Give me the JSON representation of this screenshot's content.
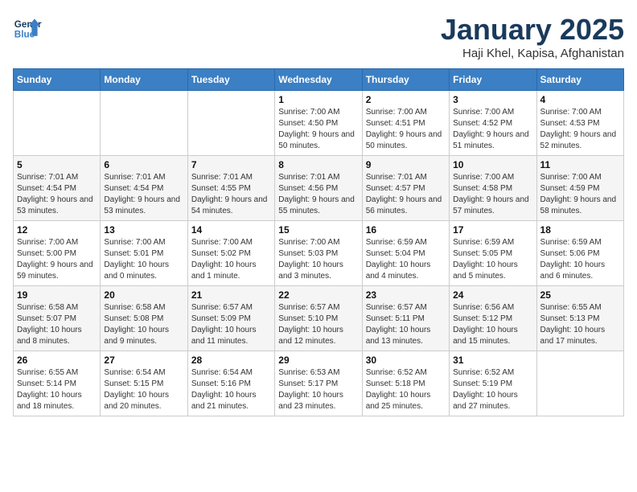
{
  "logo": {
    "line1": "General",
    "line2": "Blue"
  },
  "title": "January 2025",
  "subtitle": "Haji Khel, Kapisa, Afghanistan",
  "weekdays": [
    "Sunday",
    "Monday",
    "Tuesday",
    "Wednesday",
    "Thursday",
    "Friday",
    "Saturday"
  ],
  "weeks": [
    [
      {
        "day": "",
        "info": ""
      },
      {
        "day": "",
        "info": ""
      },
      {
        "day": "",
        "info": ""
      },
      {
        "day": "1",
        "info": "Sunrise: 7:00 AM\nSunset: 4:50 PM\nDaylight: 9 hours and 50 minutes."
      },
      {
        "day": "2",
        "info": "Sunrise: 7:00 AM\nSunset: 4:51 PM\nDaylight: 9 hours and 50 minutes."
      },
      {
        "day": "3",
        "info": "Sunrise: 7:00 AM\nSunset: 4:52 PM\nDaylight: 9 hours and 51 minutes."
      },
      {
        "day": "4",
        "info": "Sunrise: 7:00 AM\nSunset: 4:53 PM\nDaylight: 9 hours and 52 minutes."
      }
    ],
    [
      {
        "day": "5",
        "info": "Sunrise: 7:01 AM\nSunset: 4:54 PM\nDaylight: 9 hours and 53 minutes."
      },
      {
        "day": "6",
        "info": "Sunrise: 7:01 AM\nSunset: 4:54 PM\nDaylight: 9 hours and 53 minutes."
      },
      {
        "day": "7",
        "info": "Sunrise: 7:01 AM\nSunset: 4:55 PM\nDaylight: 9 hours and 54 minutes."
      },
      {
        "day": "8",
        "info": "Sunrise: 7:01 AM\nSunset: 4:56 PM\nDaylight: 9 hours and 55 minutes."
      },
      {
        "day": "9",
        "info": "Sunrise: 7:01 AM\nSunset: 4:57 PM\nDaylight: 9 hours and 56 minutes."
      },
      {
        "day": "10",
        "info": "Sunrise: 7:00 AM\nSunset: 4:58 PM\nDaylight: 9 hours and 57 minutes."
      },
      {
        "day": "11",
        "info": "Sunrise: 7:00 AM\nSunset: 4:59 PM\nDaylight: 9 hours and 58 minutes."
      }
    ],
    [
      {
        "day": "12",
        "info": "Sunrise: 7:00 AM\nSunset: 5:00 PM\nDaylight: 9 hours and 59 minutes."
      },
      {
        "day": "13",
        "info": "Sunrise: 7:00 AM\nSunset: 5:01 PM\nDaylight: 10 hours and 0 minutes."
      },
      {
        "day": "14",
        "info": "Sunrise: 7:00 AM\nSunset: 5:02 PM\nDaylight: 10 hours and 1 minute."
      },
      {
        "day": "15",
        "info": "Sunrise: 7:00 AM\nSunset: 5:03 PM\nDaylight: 10 hours and 3 minutes."
      },
      {
        "day": "16",
        "info": "Sunrise: 6:59 AM\nSunset: 5:04 PM\nDaylight: 10 hours and 4 minutes."
      },
      {
        "day": "17",
        "info": "Sunrise: 6:59 AM\nSunset: 5:05 PM\nDaylight: 10 hours and 5 minutes."
      },
      {
        "day": "18",
        "info": "Sunrise: 6:59 AM\nSunset: 5:06 PM\nDaylight: 10 hours and 6 minutes."
      }
    ],
    [
      {
        "day": "19",
        "info": "Sunrise: 6:58 AM\nSunset: 5:07 PM\nDaylight: 10 hours and 8 minutes."
      },
      {
        "day": "20",
        "info": "Sunrise: 6:58 AM\nSunset: 5:08 PM\nDaylight: 10 hours and 9 minutes."
      },
      {
        "day": "21",
        "info": "Sunrise: 6:57 AM\nSunset: 5:09 PM\nDaylight: 10 hours and 11 minutes."
      },
      {
        "day": "22",
        "info": "Sunrise: 6:57 AM\nSunset: 5:10 PM\nDaylight: 10 hours and 12 minutes."
      },
      {
        "day": "23",
        "info": "Sunrise: 6:57 AM\nSunset: 5:11 PM\nDaylight: 10 hours and 13 minutes."
      },
      {
        "day": "24",
        "info": "Sunrise: 6:56 AM\nSunset: 5:12 PM\nDaylight: 10 hours and 15 minutes."
      },
      {
        "day": "25",
        "info": "Sunrise: 6:55 AM\nSunset: 5:13 PM\nDaylight: 10 hours and 17 minutes."
      }
    ],
    [
      {
        "day": "26",
        "info": "Sunrise: 6:55 AM\nSunset: 5:14 PM\nDaylight: 10 hours and 18 minutes."
      },
      {
        "day": "27",
        "info": "Sunrise: 6:54 AM\nSunset: 5:15 PM\nDaylight: 10 hours and 20 minutes."
      },
      {
        "day": "28",
        "info": "Sunrise: 6:54 AM\nSunset: 5:16 PM\nDaylight: 10 hours and 21 minutes."
      },
      {
        "day": "29",
        "info": "Sunrise: 6:53 AM\nSunset: 5:17 PM\nDaylight: 10 hours and 23 minutes."
      },
      {
        "day": "30",
        "info": "Sunrise: 6:52 AM\nSunset: 5:18 PM\nDaylight: 10 hours and 25 minutes."
      },
      {
        "day": "31",
        "info": "Sunrise: 6:52 AM\nSunset: 5:19 PM\nDaylight: 10 hours and 27 minutes."
      },
      {
        "day": "",
        "info": ""
      }
    ]
  ]
}
